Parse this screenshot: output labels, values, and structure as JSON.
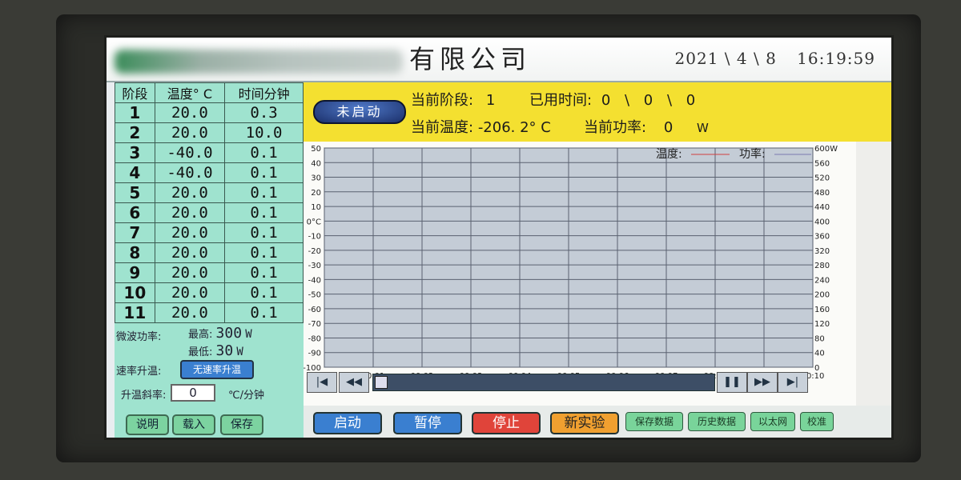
{
  "header": {
    "company_suffix": "有限公司",
    "date": "2021 \\ 4 \\ 8",
    "time": "16:19:59"
  },
  "stages_table": {
    "headers": [
      "阶段",
      "温度° C",
      "时间分钟"
    ],
    "rows": [
      {
        "stage": "1",
        "temp": "20.0",
        "time": "0.3"
      },
      {
        "stage": "2",
        "temp": "20.0",
        "time": "10.0"
      },
      {
        "stage": "3",
        "temp": "-40.0",
        "time": "0.1"
      },
      {
        "stage": "4",
        "temp": "-40.0",
        "time": "0.1"
      },
      {
        "stage": "5",
        "temp": "20.0",
        "time": "0.1"
      },
      {
        "stage": "6",
        "temp": "20.0",
        "time": "0.1"
      },
      {
        "stage": "7",
        "temp": "20.0",
        "time": "0.1"
      },
      {
        "stage": "8",
        "temp": "20.0",
        "time": "0.1"
      },
      {
        "stage": "9",
        "temp": "20.0",
        "time": "0.1"
      },
      {
        "stage": "10",
        "temp": "20.0",
        "time": "0.1"
      },
      {
        "stage": "11",
        "temp": "20.0",
        "time": "0.1"
      }
    ]
  },
  "power": {
    "label": "微波功率:",
    "max_label": "最高:",
    "max_value": "300",
    "min_label": "最低:",
    "min_value": "30",
    "unit": "W",
    "rate_label": "速率升温:",
    "rate_toggle": "无速率升温",
    "ramp_label": "升温斜率:",
    "ramp_value": "0",
    "ramp_unit": "℃/分钟"
  },
  "left_buttons": [
    "说明",
    "载入",
    "保存"
  ],
  "status": {
    "state_button": "未启动",
    "stage_label": "当前阶段:",
    "stage_value": "1",
    "elapsed_label": "已用时间:",
    "elapsed_value": "0 \\ 0 \\ 0",
    "temp_label": "当前温度:",
    "temp_value": "-206. 2° C",
    "power_label": "当前功率:",
    "power_value": "0",
    "power_unit": "W"
  },
  "chart_data": {
    "type": "line",
    "legend": [
      "温度:",
      "功率:"
    ],
    "series_colors": {
      "temp": "#d04040",
      "power": "#7a7ab0"
    },
    "left_axis_ticks": [
      "50",
      "40",
      "30",
      "20",
      "10",
      "0°C",
      "-10",
      "-20",
      "-30",
      "-40",
      "-50",
      "-60",
      "-70",
      "-80",
      "-90",
      "-100"
    ],
    "right_axis_ticks": [
      "600W",
      "560",
      "520",
      "480",
      "440",
      "400",
      "360",
      "320",
      "280",
      "240",
      "200",
      "160",
      "120",
      "80",
      "40",
      "0"
    ],
    "x_ticks": [
      "00:00",
      "00:01",
      "00:02",
      "00:03",
      "00:04",
      "00:05",
      "00:06",
      "00:07",
      "00:08",
      "00:09",
      "00:10"
    ],
    "ylim_left": [
      -100,
      50
    ],
    "ylim_right": [
      0,
      600
    ],
    "grid": true,
    "series": []
  },
  "bottom_buttons": {
    "start": "启动",
    "pause": "暂停",
    "stop": "停止",
    "new": "新实验",
    "save_data": "保存数据",
    "history": "历史数据",
    "ethernet": "以太网",
    "calibrate": "校准"
  },
  "colors": {
    "status_bg": "#f4e030",
    "table_bg": "#9fe3cf",
    "btn_blue": "#3a7fd0",
    "btn_red": "#e0443a",
    "btn_orange": "#f0a030",
    "btn_green": "#79d49a"
  }
}
